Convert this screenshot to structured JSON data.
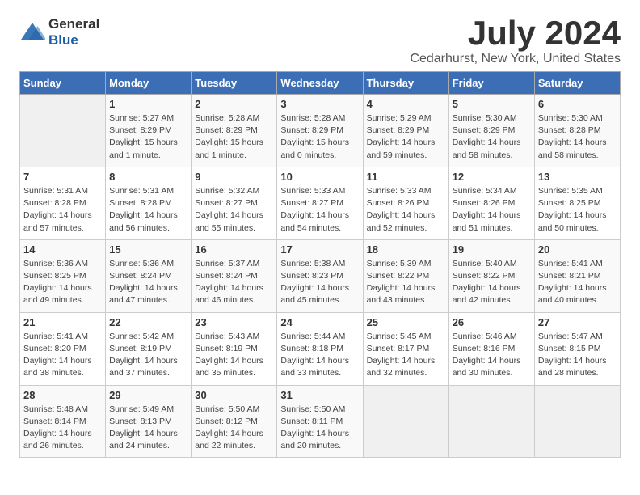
{
  "logo": {
    "general": "General",
    "blue": "Blue"
  },
  "title": "July 2024",
  "location": "Cedarhurst, New York, United States",
  "weekdays": [
    "Sunday",
    "Monday",
    "Tuesday",
    "Wednesday",
    "Thursday",
    "Friday",
    "Saturday"
  ],
  "weeks": [
    [
      {
        "day": "",
        "info": ""
      },
      {
        "day": "1",
        "info": "Sunrise: 5:27 AM\nSunset: 8:29 PM\nDaylight: 15 hours\nand 1 minute."
      },
      {
        "day": "2",
        "info": "Sunrise: 5:28 AM\nSunset: 8:29 PM\nDaylight: 15 hours\nand 1 minute."
      },
      {
        "day": "3",
        "info": "Sunrise: 5:28 AM\nSunset: 8:29 PM\nDaylight: 15 hours\nand 0 minutes."
      },
      {
        "day": "4",
        "info": "Sunrise: 5:29 AM\nSunset: 8:29 PM\nDaylight: 14 hours\nand 59 minutes."
      },
      {
        "day": "5",
        "info": "Sunrise: 5:30 AM\nSunset: 8:29 PM\nDaylight: 14 hours\nand 58 minutes."
      },
      {
        "day": "6",
        "info": "Sunrise: 5:30 AM\nSunset: 8:28 PM\nDaylight: 14 hours\nand 58 minutes."
      }
    ],
    [
      {
        "day": "7",
        "info": "Sunrise: 5:31 AM\nSunset: 8:28 PM\nDaylight: 14 hours\nand 57 minutes."
      },
      {
        "day": "8",
        "info": "Sunrise: 5:31 AM\nSunset: 8:28 PM\nDaylight: 14 hours\nand 56 minutes."
      },
      {
        "day": "9",
        "info": "Sunrise: 5:32 AM\nSunset: 8:27 PM\nDaylight: 14 hours\nand 55 minutes."
      },
      {
        "day": "10",
        "info": "Sunrise: 5:33 AM\nSunset: 8:27 PM\nDaylight: 14 hours\nand 54 minutes."
      },
      {
        "day": "11",
        "info": "Sunrise: 5:33 AM\nSunset: 8:26 PM\nDaylight: 14 hours\nand 52 minutes."
      },
      {
        "day": "12",
        "info": "Sunrise: 5:34 AM\nSunset: 8:26 PM\nDaylight: 14 hours\nand 51 minutes."
      },
      {
        "day": "13",
        "info": "Sunrise: 5:35 AM\nSunset: 8:25 PM\nDaylight: 14 hours\nand 50 minutes."
      }
    ],
    [
      {
        "day": "14",
        "info": "Sunrise: 5:36 AM\nSunset: 8:25 PM\nDaylight: 14 hours\nand 49 minutes."
      },
      {
        "day": "15",
        "info": "Sunrise: 5:36 AM\nSunset: 8:24 PM\nDaylight: 14 hours\nand 47 minutes."
      },
      {
        "day": "16",
        "info": "Sunrise: 5:37 AM\nSunset: 8:24 PM\nDaylight: 14 hours\nand 46 minutes."
      },
      {
        "day": "17",
        "info": "Sunrise: 5:38 AM\nSunset: 8:23 PM\nDaylight: 14 hours\nand 45 minutes."
      },
      {
        "day": "18",
        "info": "Sunrise: 5:39 AM\nSunset: 8:22 PM\nDaylight: 14 hours\nand 43 minutes."
      },
      {
        "day": "19",
        "info": "Sunrise: 5:40 AM\nSunset: 8:22 PM\nDaylight: 14 hours\nand 42 minutes."
      },
      {
        "day": "20",
        "info": "Sunrise: 5:41 AM\nSunset: 8:21 PM\nDaylight: 14 hours\nand 40 minutes."
      }
    ],
    [
      {
        "day": "21",
        "info": "Sunrise: 5:41 AM\nSunset: 8:20 PM\nDaylight: 14 hours\nand 38 minutes."
      },
      {
        "day": "22",
        "info": "Sunrise: 5:42 AM\nSunset: 8:19 PM\nDaylight: 14 hours\nand 37 minutes."
      },
      {
        "day": "23",
        "info": "Sunrise: 5:43 AM\nSunset: 8:19 PM\nDaylight: 14 hours\nand 35 minutes."
      },
      {
        "day": "24",
        "info": "Sunrise: 5:44 AM\nSunset: 8:18 PM\nDaylight: 14 hours\nand 33 minutes."
      },
      {
        "day": "25",
        "info": "Sunrise: 5:45 AM\nSunset: 8:17 PM\nDaylight: 14 hours\nand 32 minutes."
      },
      {
        "day": "26",
        "info": "Sunrise: 5:46 AM\nSunset: 8:16 PM\nDaylight: 14 hours\nand 30 minutes."
      },
      {
        "day": "27",
        "info": "Sunrise: 5:47 AM\nSunset: 8:15 PM\nDaylight: 14 hours\nand 28 minutes."
      }
    ],
    [
      {
        "day": "28",
        "info": "Sunrise: 5:48 AM\nSunset: 8:14 PM\nDaylight: 14 hours\nand 26 minutes."
      },
      {
        "day": "29",
        "info": "Sunrise: 5:49 AM\nSunset: 8:13 PM\nDaylight: 14 hours\nand 24 minutes."
      },
      {
        "day": "30",
        "info": "Sunrise: 5:50 AM\nSunset: 8:12 PM\nDaylight: 14 hours\nand 22 minutes."
      },
      {
        "day": "31",
        "info": "Sunrise: 5:50 AM\nSunset: 8:11 PM\nDaylight: 14 hours\nand 20 minutes."
      },
      {
        "day": "",
        "info": ""
      },
      {
        "day": "",
        "info": ""
      },
      {
        "day": "",
        "info": ""
      }
    ]
  ]
}
